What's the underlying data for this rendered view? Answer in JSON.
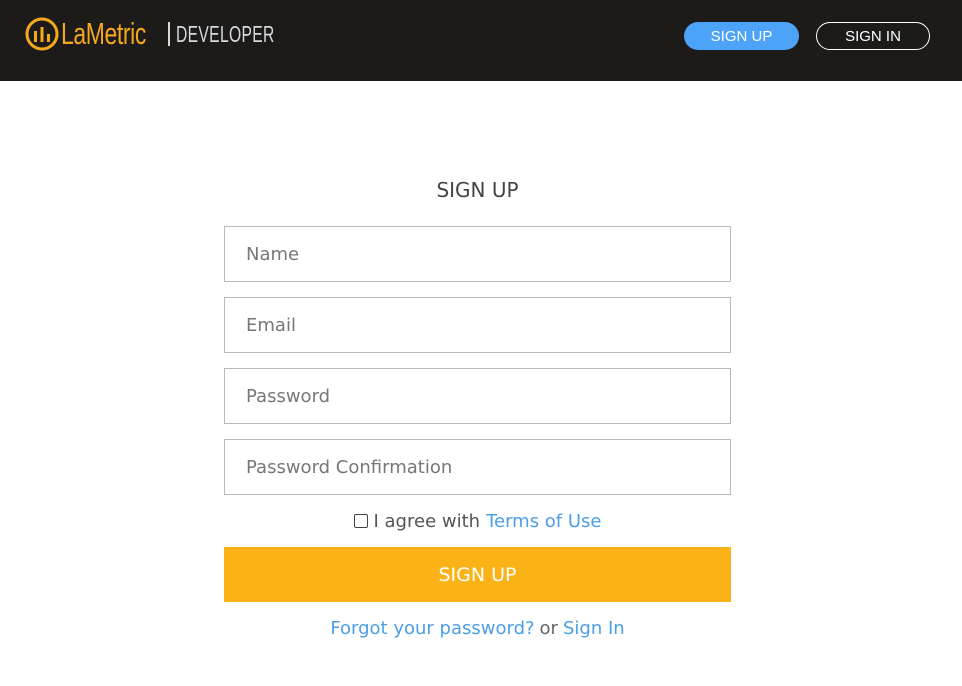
{
  "header": {
    "logo_brand": "LaMetric",
    "logo_sub": "DEVELOPER",
    "signup_label": "SIGN UP",
    "signin_label": "SIGN IN"
  },
  "form": {
    "title": "SIGN UP",
    "name_placeholder": "Name",
    "email_placeholder": "Email",
    "password_placeholder": "Password",
    "password_confirm_placeholder": "Password Confirmation",
    "agree_text": "I agree with",
    "terms_link": "Terms of Use",
    "submit_label": "SIGN UP",
    "forgot_link": "Forgot your password?",
    "or_text": "or",
    "signin_link": "Sign In"
  },
  "colors": {
    "brand": "#f4a81d",
    "primary_blue": "#4ca3f7",
    "submit": "#fbb216",
    "header_bg": "#1d1b1a",
    "link": "#4c9ee6"
  },
  "icons": {
    "logo_mark": "lametric-logo-icon",
    "checkbox": "checkbox-unchecked"
  }
}
